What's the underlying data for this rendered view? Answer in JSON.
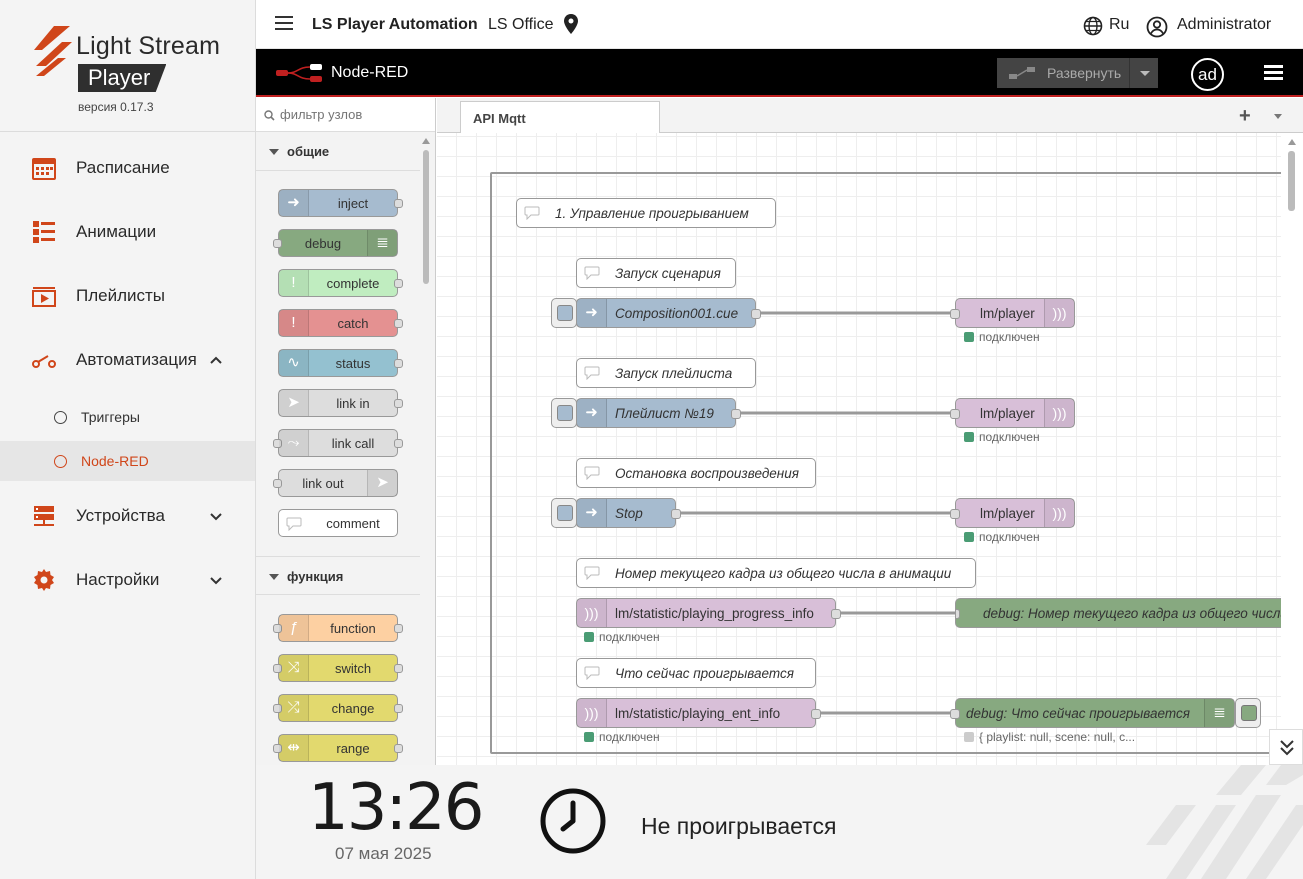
{
  "brand": {
    "title": "Light Stream",
    "product": "Player",
    "version": "версия 0.17.3"
  },
  "sidebar": {
    "items": [
      {
        "label": "Расписание",
        "icon": "calendar-icon"
      },
      {
        "label": "Анимации",
        "icon": "list-icon"
      },
      {
        "label": "Плейлисты",
        "icon": "playlist-icon"
      },
      {
        "label": "Автоматизация",
        "icon": "automation-switch-icon",
        "expanded": true
      },
      {
        "label": "Устройства",
        "icon": "devices-icon"
      },
      {
        "label": "Настройки",
        "icon": "gear-icon"
      }
    ],
    "subitems": [
      {
        "label": "Триггеры",
        "active": false
      },
      {
        "label": "Node-RED",
        "active": true
      }
    ]
  },
  "header": {
    "app_title": "LS Player Automation",
    "location": "LS Office",
    "language": "Ru",
    "user": "Administrator"
  },
  "nodered": {
    "title": "Node-RED",
    "deploy_label": "Развернуть",
    "avatar": "ad",
    "palette": {
      "filter_placeholder": "фильтр узлов",
      "categories": [
        {
          "label": "общие",
          "nodes": [
            "inject",
            "debug",
            "complete",
            "catch",
            "status",
            "link in",
            "link call",
            "link out",
            "comment"
          ]
        },
        {
          "label": "функция",
          "nodes": [
            "function",
            "switch",
            "change",
            "range"
          ]
        }
      ]
    },
    "tab": "API Mqtt",
    "flow": {
      "group_comment": "1. Управление проигрыванием",
      "comments": [
        "Запуск сценария",
        "Запуск плейлиста",
        "Остановка воспроизведения",
        "Номер текущего кадра из общего числа в анимации",
        "Что сейчас проигрывается"
      ],
      "injects": [
        "Composition001.cue",
        "Плейлист №19",
        "Stop"
      ],
      "mqtt_out": "lm/player",
      "mqtt_in": [
        "lm/statistic/playing_progress_info",
        "lm/statistic/playing_ent_info"
      ],
      "debug": [
        "debug: Номер текущего кадра из общего числа в анимации",
        "debug: Что сейчас проигрывается"
      ],
      "status_connected": "подключен",
      "debug_status": "{ playlist: null, scene: null, c..."
    }
  },
  "footer": {
    "time": "13:26",
    "date": "07 мая 2025",
    "playback_status": "Не проигрывается"
  },
  "colors": {
    "accent": "#d0461a",
    "inject": "#a6bbcf",
    "debug": "#87a980",
    "complete": "#c0edc0",
    "catch": "#e49191",
    "status": "#94c1d0",
    "link": "#dddddd",
    "mqtt": "#d8bfd8",
    "function": "#fdd0a2",
    "switch": "#e2d96e"
  }
}
